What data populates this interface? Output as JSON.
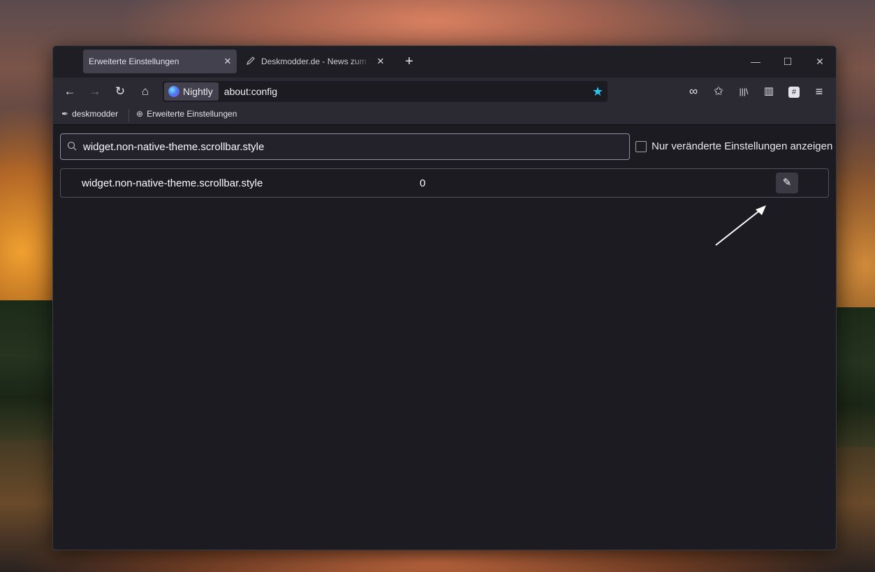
{
  "tabs": [
    {
      "label": "Erweiterte Einstellungen",
      "active": true,
      "close": "✕"
    },
    {
      "label": "Deskmodder.de - News zum Thema",
      "active": false,
      "close": "✕",
      "icon": "pen-favicon-icon"
    }
  ],
  "new_tab": "+",
  "window_controls": {
    "minimize": "—",
    "maximize": "☐",
    "close": "✕"
  },
  "navbar": {
    "back": "←",
    "forward": "→",
    "reload": "↻",
    "home": "⌂",
    "identity_label": "Nightly",
    "url": "about:config",
    "star": "★",
    "tools": {
      "private": "∞",
      "extensions": "✩",
      "library": "|||\\",
      "sidebar": "▥",
      "hash": "#",
      "menu": "≡"
    }
  },
  "bookmarks": [
    {
      "label": "deskmodder",
      "icon": "✒"
    },
    {
      "label": "Erweiterte Einstellungen",
      "icon": "⊕"
    }
  ],
  "config": {
    "search_value": "widget.non-native-theme.scrollbar.style",
    "search_icon": "⚲",
    "checkbox_label": "Nur veränderte Einstellungen anzeigen",
    "rows": [
      {
        "name": "widget.non-native-theme.scrollbar.style",
        "value": "0",
        "edit_icon": "✎"
      }
    ]
  },
  "colors": {
    "accent_star": "#29c6f2",
    "window_bg": "#1c1b22",
    "toolbar_bg": "#2b2a33"
  }
}
